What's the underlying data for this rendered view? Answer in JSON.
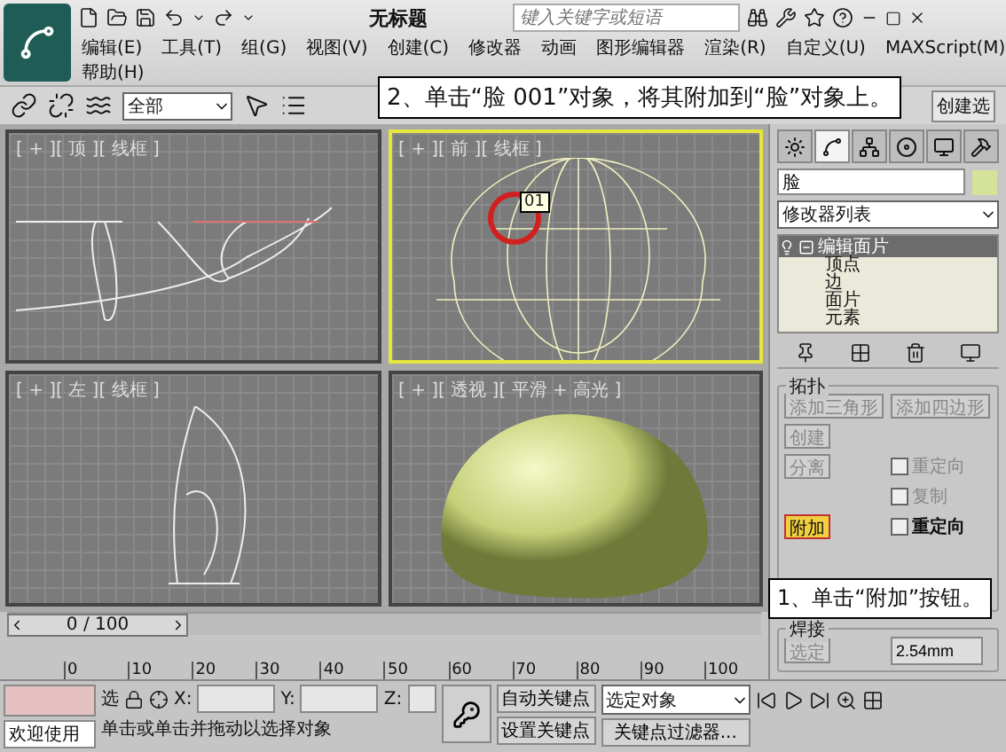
{
  "window": {
    "title": "无标题",
    "search": {
      "placeholder": "键入关键字或短语"
    }
  },
  "menu_rows": [
    [
      "编辑(E)",
      "工具(T)",
      "组(G)",
      "视图(V)",
      "创建(C)",
      "修改器",
      "动画",
      "图形编辑器",
      "渲染(R)",
      "自定义(U)",
      "MAXScript(M)"
    ],
    [
      "帮助(H)"
    ]
  ],
  "toolbar": {
    "selection_filter": "全部",
    "create_selection": "创建选"
  },
  "callouts": [
    "2、单击“脸 001”对象，将其附加到“脸”对象上。",
    "1、单击“附加”按钮。"
  ],
  "viewports": [
    {
      "kind": "top",
      "label": "[ + ][ 顶 ][ 线框 ]",
      "active": false
    },
    {
      "kind": "front",
      "label": "[ + ][ 前 ][ 线框 ]",
      "active": true,
      "tooltip": "01"
    },
    {
      "kind": "left",
      "label": "[ + ][ 左 ][ 线框 ]",
      "active": false
    },
    {
      "kind": "perspective",
      "label": "[ + ][ 透视 ][ 平滑 + 高光 ]",
      "active": false
    }
  ],
  "command_panel": {
    "tabs": [
      {
        "kind": "create",
        "selected": false
      },
      {
        "kind": "modify",
        "selected": true
      },
      {
        "kind": "hierarchy",
        "selected": false
      },
      {
        "kind": "motion",
        "selected": false
      },
      {
        "kind": "display",
        "selected": false
      },
      {
        "kind": "utilities",
        "selected": false
      }
    ],
    "object_name": "脸",
    "modifier_list": "修改器列表",
    "stack": [
      {
        "label": "编辑面片",
        "selected": true,
        "expanded": true,
        "children": [
          {
            "label": "顶点"
          },
          {
            "label": "边"
          },
          {
            "label": "面片"
          },
          {
            "label": "元素"
          }
        ]
      }
    ],
    "topology": {
      "title": "拓扑",
      "rows": [
        [
          {
            "kind": "button",
            "label": "添加三角形",
            "disabled": true,
            "selected": false
          },
          {
            "kind": "button",
            "label": "添加四边形",
            "disabled": true,
            "selected": false
          }
        ],
        [
          {
            "kind": "button",
            "label": "创建",
            "disabled": true,
            "selected": false
          }
        ],
        [
          {
            "kind": "button",
            "label": "分离",
            "disabled": true,
            "selected": false
          },
          {
            "kind": "checkbox",
            "label": "重定向",
            "disabled": true,
            "checked": false
          }
        ],
        [
          "",
          {
            "kind": "checkbox",
            "label": "复制",
            "disabled": true,
            "checked": false
          }
        ],
        [
          {
            "kind": "button",
            "label": "附加",
            "disabled": false,
            "selected": true
          },
          {
            "kind": "checkbox",
            "label": "重定向",
            "disabled": false,
            "checked": false
          }
        ]
      ]
    },
    "weld": {
      "title": "焊接",
      "button": "选定",
      "threshold": "2.54mm"
    }
  },
  "timeline": {
    "frame": "0 / 100",
    "level": 0,
    "ticks": [
      "0",
      "10",
      "20",
      "30",
      "40",
      "50",
      "60",
      "70",
      "80",
      "90",
      "100"
    ]
  },
  "status": {
    "welcome": "欢迎使用",
    "lock_label": "选",
    "x_label": "X:",
    "y_label": "Y:",
    "z_label": "Z:",
    "prompt": "单击或单击并拖动以选择对象",
    "auto_key": "自动关键点",
    "set_key": "设置关键点",
    "key_mode": "选定对象",
    "key_filters": "关键点过滤器..."
  }
}
